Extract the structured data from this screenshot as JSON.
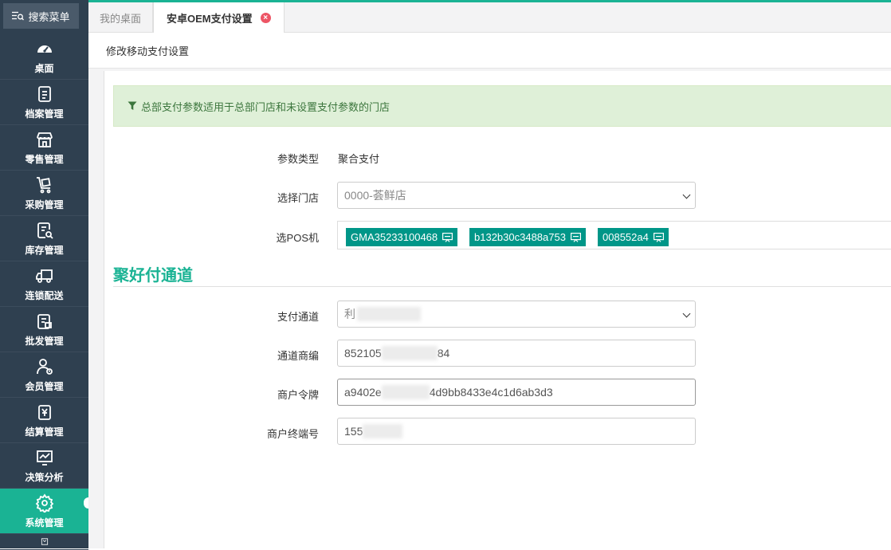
{
  "sidebar": {
    "search_label": "搜索菜单",
    "items": [
      {
        "label": "桌面",
        "icon": "dashboard-icon"
      },
      {
        "label": "档案管理",
        "icon": "archive-icon"
      },
      {
        "label": "零售管理",
        "icon": "store-icon"
      },
      {
        "label": "采购管理",
        "icon": "purchase-cart-icon"
      },
      {
        "label": "库存管理",
        "icon": "inventory-icon"
      },
      {
        "label": "连锁配送",
        "icon": "delivery-truck-icon"
      },
      {
        "label": "批发管理",
        "icon": "wholesale-icon"
      },
      {
        "label": "会员管理",
        "icon": "member-icon"
      },
      {
        "label": "结算管理",
        "icon": "settlement-icon"
      },
      {
        "label": "决策分析",
        "icon": "chart-icon"
      },
      {
        "label": "系统管理",
        "icon": "gear-icon"
      }
    ],
    "active_index": 10,
    "accent_color": "#1ab394",
    "bg_color": "#2f4050"
  },
  "tabs": {
    "home": "我的桌面",
    "active": "安卓OEM支付设置",
    "close_icon": "close-circle-icon"
  },
  "page": {
    "title": "修改移动支付设置",
    "alert": "总部支付参数适用于总部门店和未设置支付参数的门店",
    "alert_icon": "filter-icon"
  },
  "form": {
    "param_type_label": "参数类型",
    "param_type_value": "聚合支付",
    "store_label": "选择门店",
    "store_value": "0000-荟鲜店",
    "pos_label": "选POS机",
    "pos_devices": [
      "GMA35233100468",
      "b132b30c3488a753",
      "008552a4"
    ]
  },
  "channel": {
    "section_title": "聚好付通道",
    "pay_channel_label": "支付通道",
    "pay_channel_value_visible": "利",
    "merchant_no_label": "通道商编",
    "merchant_no_prefix": "852105",
    "merchant_no_suffix": "84",
    "token_label": "商户令牌",
    "token_prefix": "a9402e",
    "token_suffix": "4d9bb8433e4c1d6ab3d3",
    "terminal_label": "商户终端号",
    "terminal_prefix": "155"
  }
}
